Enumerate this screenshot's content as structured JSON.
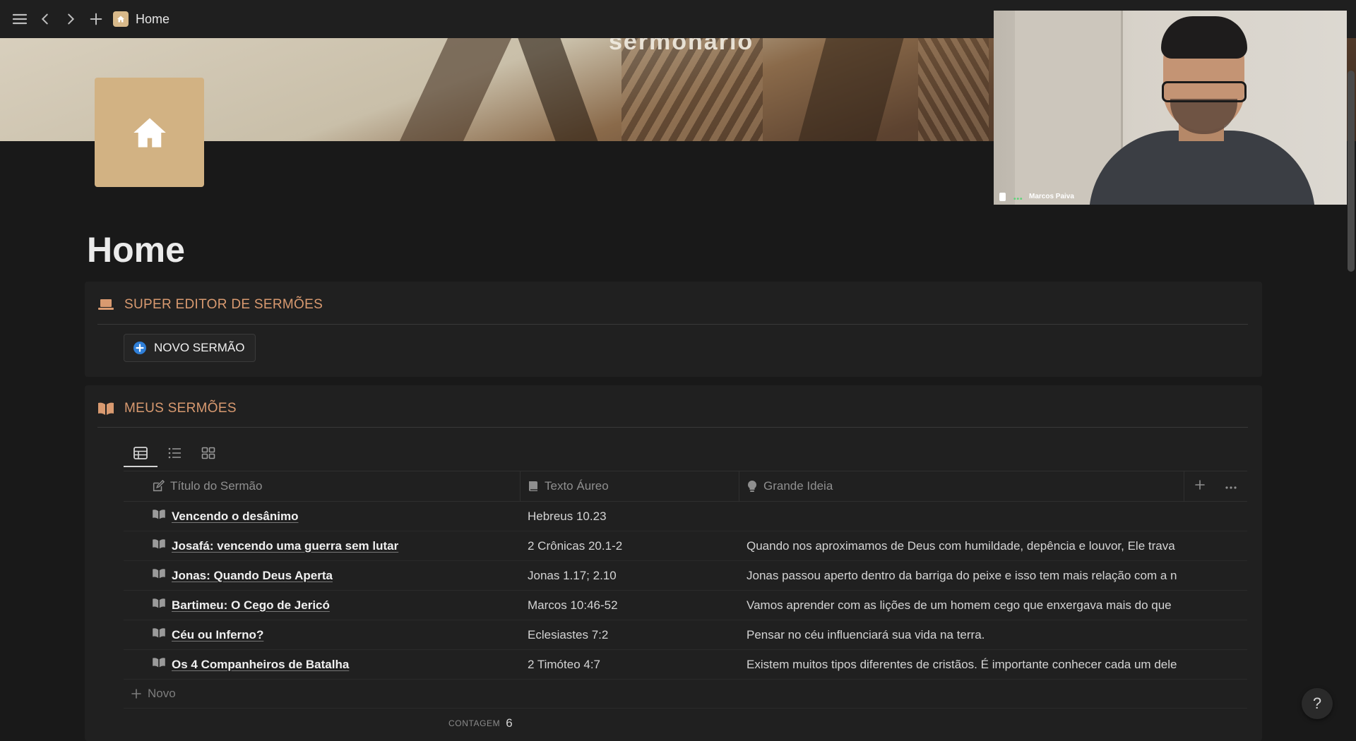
{
  "topbar": {
    "breadcrumb": "Home"
  },
  "cover": {
    "caption": "sermonário"
  },
  "video": {
    "participant_name": "Marcos Paiva",
    "dots": "•••"
  },
  "page": {
    "title": "Home"
  },
  "editor": {
    "title": "SUPER EDITOR DE SERMÕES",
    "new_button": "NOVO SERMÃO"
  },
  "sermons": {
    "title": "MEUS SERMÕES",
    "views": [
      "table-view-icon",
      "list-view-icon",
      "gallery-view-icon"
    ],
    "columns": [
      "Título do Sermão",
      "Texto Áureo",
      "Grande Ideia"
    ],
    "rows": [
      {
        "title": "Vencendo o desânimo",
        "text": "Hebreus 10.23",
        "idea": ""
      },
      {
        "title": "Josafá: vencendo uma guerra sem lutar",
        "text": "2 Crônicas 20.1-2",
        "idea": "Quando nos aproximamos de Deus com humildade, depência e louvor, Ele trava"
      },
      {
        "title": "Jonas: Quando Deus Aperta",
        "text": "Jonas 1.17; 2.10",
        "idea": "Jonas passou aperto dentro da barriga do peixe e isso tem mais relação com a n"
      },
      {
        "title": "Bartimeu: O Cego de Jericó",
        "text": "Marcos 10:46-52",
        "idea": "Vamos aprender com as lições de um homem cego que enxergava mais do que"
      },
      {
        "title": "Céu ou Inferno?",
        "text": "Eclesiastes 7:2",
        "idea": "Pensar no céu influenciará sua vida na terra."
      },
      {
        "title": "Os 4 Companheiros de Batalha",
        "text": "2 Timóteo 4:7",
        "idea": "Existem muitos tipos diferentes de cristãos. É importante conhecer cada um dele"
      }
    ],
    "add_label": "Novo",
    "count_label": "CONTAGEM",
    "count_value": "6"
  },
  "help": {
    "label": "?"
  },
  "colors": {
    "accent": "#d99a70",
    "icon_bg": "#d2b283",
    "background": "#191919",
    "callout": "#202020"
  }
}
